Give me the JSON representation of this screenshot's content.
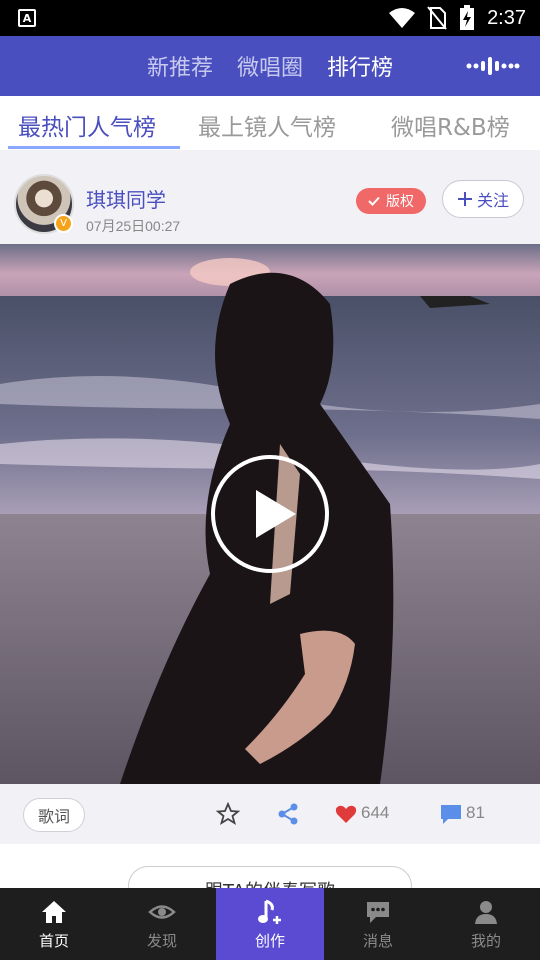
{
  "status_bar": {
    "time": "2:37",
    "app_badge": "A"
  },
  "top_nav": {
    "tabs": [
      "新推荐",
      "微唱圈",
      "排行榜"
    ],
    "active_index": 2
  },
  "sub_tabs": {
    "tabs": [
      "最热门人气榜",
      "最上镜人气榜",
      "微唱R&B榜"
    ],
    "active_index": 0
  },
  "post": {
    "username": "琪琪同学",
    "time": "07月25日00:27",
    "avatar_badge": "V",
    "copyright_label": "版权",
    "follow_label": "关注"
  },
  "actions": {
    "lyrics_label": "歌词",
    "likes": "644",
    "comments": "81"
  },
  "sing_button": "跟TA的伴奏写歌",
  "bottom_nav": {
    "items": [
      "首页",
      "发现",
      "创作",
      "消息",
      "我的"
    ]
  },
  "colors": {
    "brand": "#4a4fbf",
    "create_tab": "#5b4bd2",
    "badge": "#f06868",
    "heart": "#e03b3b",
    "comment": "#5a8ee8"
  }
}
